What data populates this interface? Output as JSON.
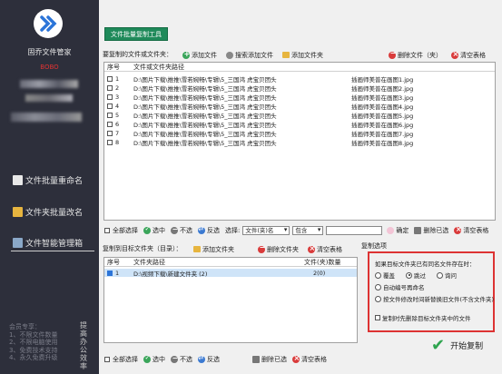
{
  "sidebar": {
    "app_title": "固乔文件管家",
    "reg_code": "BOBO",
    "nav": [
      {
        "label": "文件批量重命名"
      },
      {
        "label": "文件夹批量改名"
      },
      {
        "label": "文件智能管理箱"
      }
    ],
    "promo_lines": [
      "会员专享：",
      "1、不限文件数量",
      "2、不限电脑使用",
      "3、免费技术支持",
      "4、永久免费升级"
    ],
    "vertical_text": "提高办公效率",
    "colors": {
      "bg": "#2d2f3b",
      "reg": "#dd3333"
    }
  },
  "top": {
    "tab_label": "文件批量复制工具",
    "section_label": "要复制的文件或文件夹：",
    "buttons": {
      "add_file": "添加文件",
      "search_add": "搜索添加文件",
      "add_folder": "添加文件夹",
      "delete_file": "删除文件（夹）",
      "clear_table": "清空表格"
    },
    "headers": {
      "no": "序号",
      "path": "文件或文件夹路径",
      "preview": ""
    },
    "rows": [
      {
        "no": "1",
        "path": "D:\\图片下载\\推推\\雪若婉畅\\专辑\\5_三国鸿 虎宝贝团头",
        "preview": "插画师美普在画图1.jpg"
      },
      {
        "no": "2",
        "path": "D:\\图片下载\\推推\\雪若婉畅\\专辑\\5_三国鸿 虎宝贝团头",
        "preview": "插画师美普在画图2.jpg"
      },
      {
        "no": "3",
        "path": "D:\\图片下载\\推推\\雪若婉畅\\专辑\\5_三国鸿 虎宝贝团头",
        "preview": "插画师美普在画图3.jpg"
      },
      {
        "no": "4",
        "path": "D:\\图片下载\\推推\\雪若婉畅\\专辑\\5_三国鸿 虎宝贝团头",
        "preview": "插画师美普在画图4.jpg"
      },
      {
        "no": "5",
        "path": "D:\\图片下载\\推推\\雪若婉畅\\专辑\\5_三国鸿 虎宝贝团头",
        "preview": "插画师美普在画图5.jpg"
      },
      {
        "no": "6",
        "path": "D:\\图片下载\\推推\\雪若婉畅\\专辑\\5_三国鸿 虎宝贝团头",
        "preview": "插画师美普在画图6.jpg"
      },
      {
        "no": "7",
        "path": "D:\\图片下载\\推推\\雪若婉畅\\专辑\\5_三国鸿 虎宝贝团头",
        "preview": "插画师美普在画图7.jpg"
      },
      {
        "no": "8",
        "path": "D:\\图片下载\\推推\\雪若婉畅\\专辑\\5_三国鸿 虎宝贝团头",
        "preview": "插画师美普在画图8.jpg"
      }
    ],
    "filter": {
      "select_all": "全部选择",
      "select": "选中",
      "deselect": "不选",
      "invert": "反选",
      "choose_label": "选择:",
      "field_option": "文件(夹)名",
      "match_option": "包含",
      "input_value": "",
      "confirm": "确定",
      "delete_selected": "删除已选",
      "clear_table": "清空表格"
    }
  },
  "bottom": {
    "section_label": "复制到目标文件夹（目录）：",
    "buttons": {
      "add_folder": "添加文件夹",
      "delete_folder": "删除文件夹",
      "clear_table": "清空表格"
    },
    "headers": {
      "no": "序号",
      "path": "文件夹路径",
      "count": "文件(夹)数量"
    },
    "rows": [
      {
        "no": "1",
        "path": "D:\\视频下载\\新建文件夹 (2)",
        "count": "2(0)"
      }
    ],
    "filter": {
      "select_all": "全部选择",
      "select": "选中",
      "deselect": "不选",
      "invert": "反选",
      "delete_selected": "删除已选",
      "clear_table": "清空表格"
    }
  },
  "options": {
    "title": "复制选项",
    "question": "如果目标文件夹已有同名文件存在时：",
    "radio_overwrite": "覆盖",
    "radio_skip": "跳过",
    "radio_ask": "询问",
    "selected": "跳过",
    "opt_auto_rename": "自动编号再命名",
    "opt_replace_newer": "按文件修改时间新替换旧文件(不含文件夹)",
    "opt_clear_first": "复制时先删除目标文件夹中的文件",
    "colors": {
      "highlight": "#dd3333"
    }
  },
  "start_label": "开始复制"
}
